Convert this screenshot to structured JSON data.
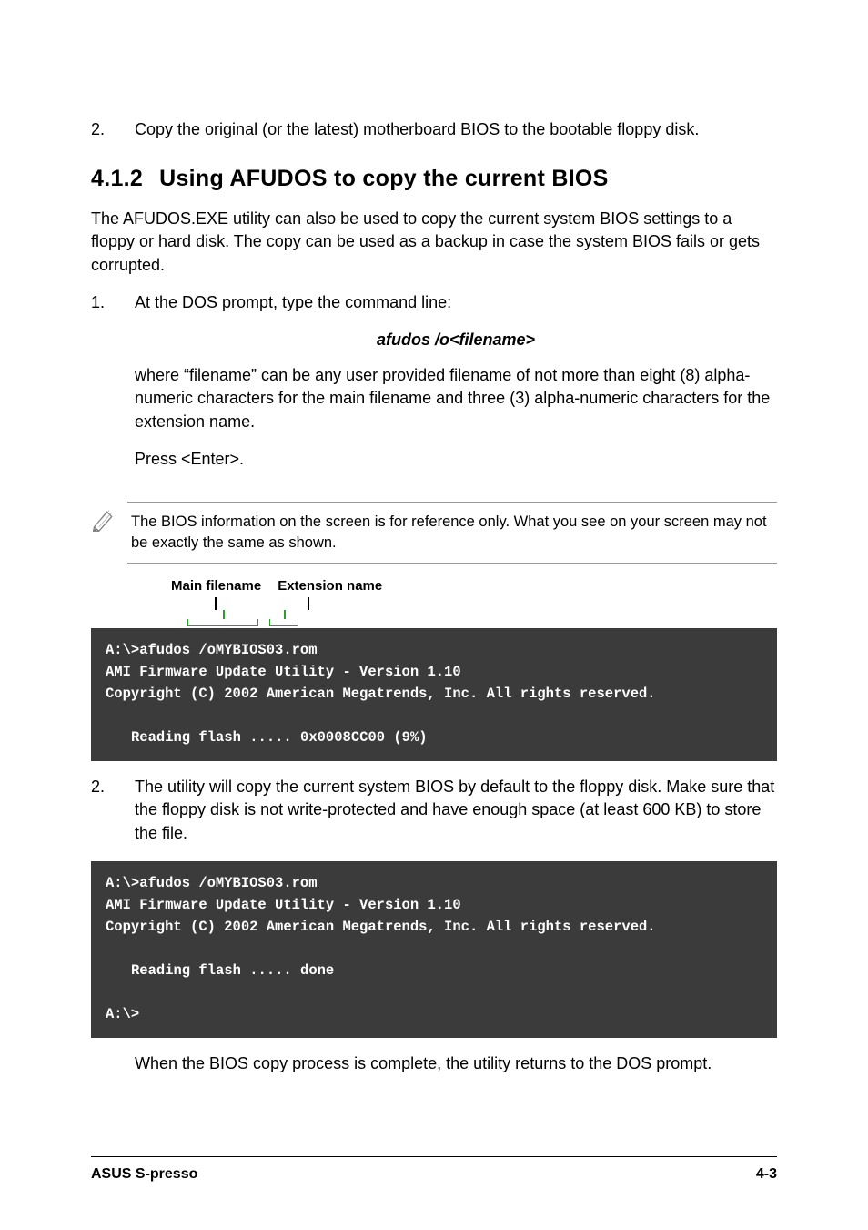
{
  "intro_item": {
    "num": "2.",
    "text": "Copy the original (or the latest) motherboard BIOS to the bootable floppy disk."
  },
  "section": {
    "num": "4.1.2",
    "title": "Using AFUDOS to copy the current BIOS"
  },
  "para1": "The AFUDOS.EXE utility can also be used to copy the current system BIOS settings to a floppy or hard disk. The copy can be used as a backup in case the system BIOS fails or gets corrupted.",
  "step1": {
    "num": "1.",
    "lead": "At the DOS prompt, type the command line:",
    "cmd": "afudos /o<filename>",
    "desc": "where “filename” can be any user provided filename of not more than eight (8) alpha-numeric characters for the main filename and three (3) alpha-numeric characters for the extension name.",
    "press": "Press <Enter>."
  },
  "note": "The BIOS information on the screen is for reference only. What you see on your screen may not be exactly the same as shown.",
  "labels": {
    "main": "Main filename",
    "ext": "Extension name"
  },
  "terminal1": {
    "l1": "A:\\>afudos /oMYBIOS03.rom",
    "l2": "AMI Firmware Update Utility - Version 1.10",
    "l3": "Copyright (C) 2002 American Megatrends, Inc. All rights reserved.",
    "l4": "Reading flash ..... 0x0008CC00 (9%)"
  },
  "step2": {
    "num": "2.",
    "text": "The utility will copy the current system BIOS by default to the floppy disk. Make sure that the floppy disk is not write-protected and have enough space (at least 600 KB) to store the file."
  },
  "terminal2": {
    "l1": "A:\\>afudos /oMYBIOS03.rom",
    "l2": "AMI Firmware Update Utility - Version 1.10",
    "l3": "Copyright (C) 2002 American Megatrends, Inc. All rights reserved.",
    "l4": "Reading flash ..... done",
    "l5": "A:\\>"
  },
  "closing": "When the BIOS copy process is complete, the utility returns to the DOS prompt.",
  "footer": {
    "left": "ASUS S-presso",
    "right": "4-3"
  }
}
